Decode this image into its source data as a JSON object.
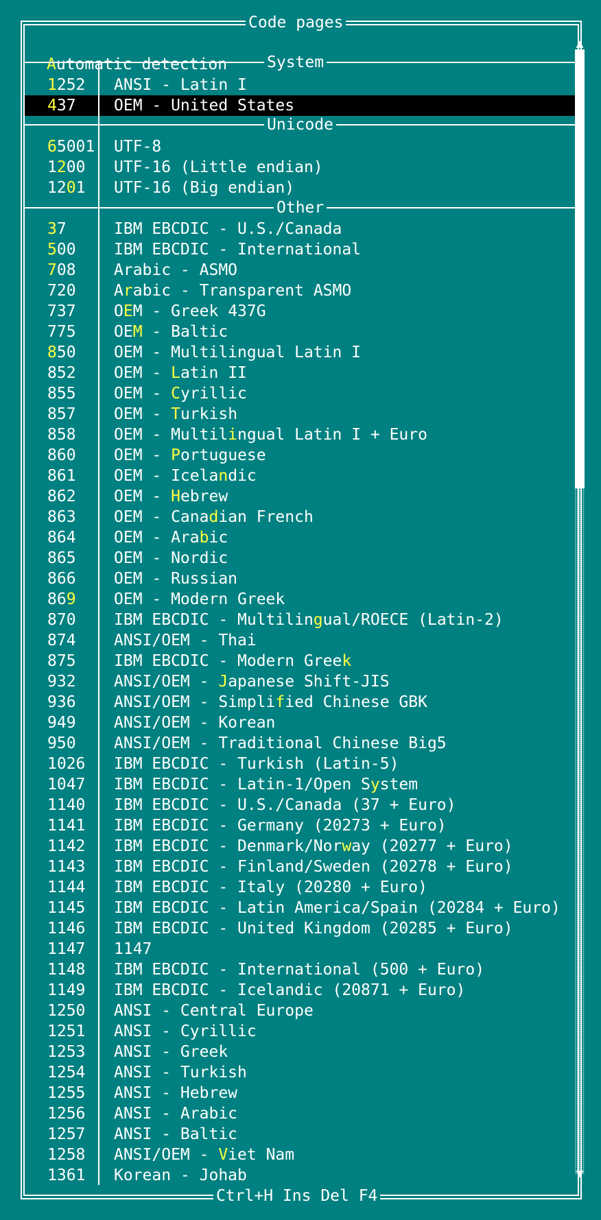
{
  "dialog": {
    "title": "Code pages",
    "footer": "Ctrl+H Ins Del F4",
    "auto_detect": {
      "hot": "A",
      "rest": "utomatic detection"
    },
    "scroll_up_icon": "▲",
    "scroll_down_icon": "▼"
  },
  "sections": {
    "system": "System",
    "unicode": "Unicode",
    "other": "Other"
  },
  "system_rows": [
    {
      "code": [
        [
          "1",
          "h"
        ],
        [
          "252",
          "n"
        ]
      ],
      "name": [
        [
          "ANSI - Latin I",
          "n"
        ]
      ]
    },
    {
      "code": [
        [
          "4",
          "h"
        ],
        [
          "37",
          "n"
        ]
      ],
      "name": [
        [
          "OEM - United States",
          "n"
        ]
      ],
      "selected": true
    }
  ],
  "unicode_rows": [
    {
      "code": [
        [
          "6",
          "h"
        ],
        [
          "5001",
          "n"
        ]
      ],
      "name": [
        [
          "UTF-8",
          "n"
        ]
      ]
    },
    {
      "code": [
        [
          "1",
          "n"
        ],
        [
          "2",
          "h"
        ],
        [
          "00",
          "n"
        ]
      ],
      "name": [
        [
          "UTF-16 (Little endian)",
          "n"
        ]
      ]
    },
    {
      "code": [
        [
          "12",
          "n"
        ],
        [
          "0",
          "h"
        ],
        [
          "1",
          "n"
        ]
      ],
      "name": [
        [
          "UTF-16 (Big endian)",
          "n"
        ]
      ]
    }
  ],
  "other_rows": [
    {
      "code": [
        [
          "3",
          "h"
        ],
        [
          "7",
          "n"
        ]
      ],
      "name": [
        [
          "IBM EBCDIC - U.S./Canada",
          "n"
        ]
      ]
    },
    {
      "code": [
        [
          "5",
          "h"
        ],
        [
          "00",
          "n"
        ]
      ],
      "name": [
        [
          "IBM EBCDIC - International",
          "n"
        ]
      ]
    },
    {
      "code": [
        [
          "7",
          "h"
        ],
        [
          "08",
          "n"
        ]
      ],
      "name": [
        [
          "Arabic - ASMO",
          "n"
        ]
      ]
    },
    {
      "code": [
        [
          "720",
          "n"
        ]
      ],
      "name": [
        [
          "A",
          "n"
        ],
        [
          "r",
          "h"
        ],
        [
          "abic - Transparent ASMO",
          "n"
        ]
      ]
    },
    {
      "code": [
        [
          "737",
          "n"
        ]
      ],
      "name": [
        [
          "O",
          "n"
        ],
        [
          "E",
          "h"
        ],
        [
          "M - Greek 437G",
          "n"
        ]
      ]
    },
    {
      "code": [
        [
          "775",
          "n"
        ]
      ],
      "name": [
        [
          "OE",
          "n"
        ],
        [
          "M",
          "h"
        ],
        [
          " - Baltic",
          "n"
        ]
      ]
    },
    {
      "code": [
        [
          "8",
          "h"
        ],
        [
          "50",
          "n"
        ]
      ],
      "name": [
        [
          "OEM - Multilingual Latin I",
          "n"
        ]
      ]
    },
    {
      "code": [
        [
          "852",
          "n"
        ]
      ],
      "name": [
        [
          "OEM - ",
          "n"
        ],
        [
          "L",
          "h"
        ],
        [
          "atin II",
          "n"
        ]
      ]
    },
    {
      "code": [
        [
          "855",
          "n"
        ]
      ],
      "name": [
        [
          "OEM - ",
          "n"
        ],
        [
          "C",
          "h"
        ],
        [
          "yrillic",
          "n"
        ]
      ]
    },
    {
      "code": [
        [
          "857",
          "n"
        ]
      ],
      "name": [
        [
          "OEM - ",
          "n"
        ],
        [
          "T",
          "h"
        ],
        [
          "urkish",
          "n"
        ]
      ]
    },
    {
      "code": [
        [
          "858",
          "n"
        ]
      ],
      "name": [
        [
          "OEM - Multil",
          "n"
        ],
        [
          "i",
          "h"
        ],
        [
          "ngual Latin I + Euro",
          "n"
        ]
      ]
    },
    {
      "code": [
        [
          "860",
          "n"
        ]
      ],
      "name": [
        [
          "OEM - ",
          "n"
        ],
        [
          "P",
          "h"
        ],
        [
          "ortuguese",
          "n"
        ]
      ]
    },
    {
      "code": [
        [
          "861",
          "n"
        ]
      ],
      "name": [
        [
          "OEM - Icela",
          "n"
        ],
        [
          "n",
          "h"
        ],
        [
          "dic",
          "n"
        ]
      ]
    },
    {
      "code": [
        [
          "862",
          "n"
        ]
      ],
      "name": [
        [
          "OEM - ",
          "n"
        ],
        [
          "H",
          "h"
        ],
        [
          "ebrew",
          "n"
        ]
      ]
    },
    {
      "code": [
        [
          "863",
          "n"
        ]
      ],
      "name": [
        [
          "OEM - Cana",
          "n"
        ],
        [
          "d",
          "h"
        ],
        [
          "ian French",
          "n"
        ]
      ]
    },
    {
      "code": [
        [
          "864",
          "n"
        ]
      ],
      "name": [
        [
          "OEM - Ara",
          "n"
        ],
        [
          "b",
          "h"
        ],
        [
          "ic",
          "n"
        ]
      ]
    },
    {
      "code": [
        [
          "865",
          "n"
        ]
      ],
      "name": [
        [
          "OEM - Nordic",
          "n"
        ]
      ]
    },
    {
      "code": [
        [
          "866",
          "n"
        ]
      ],
      "name": [
        [
          "OEM - Russian",
          "n"
        ]
      ]
    },
    {
      "code": [
        [
          "86",
          "n"
        ],
        [
          "9",
          "h"
        ]
      ],
      "name": [
        [
          "OEM - Modern Greek",
          "n"
        ]
      ]
    },
    {
      "code": [
        [
          "870",
          "n"
        ]
      ],
      "name": [
        [
          "IBM EBCDIC - Multilin",
          "n"
        ],
        [
          "g",
          "h"
        ],
        [
          "ual/ROECE (Latin-2)",
          "n"
        ]
      ]
    },
    {
      "code": [
        [
          "874",
          "n"
        ]
      ],
      "name": [
        [
          "ANSI/OEM - Thai",
          "n"
        ]
      ]
    },
    {
      "code": [
        [
          "875",
          "n"
        ]
      ],
      "name": [
        [
          "IBM EBCDIC - Modern Gree",
          "n"
        ],
        [
          "k",
          "h"
        ]
      ]
    },
    {
      "code": [
        [
          "932",
          "n"
        ]
      ],
      "name": [
        [
          "ANSI/OEM - ",
          "n"
        ],
        [
          "J",
          "h"
        ],
        [
          "apanese Shift-JIS",
          "n"
        ]
      ]
    },
    {
      "code": [
        [
          "936",
          "n"
        ]
      ],
      "name": [
        [
          "ANSI/OEM - Simpli",
          "n"
        ],
        [
          "f",
          "h"
        ],
        [
          "ied Chinese GBK",
          "n"
        ]
      ]
    },
    {
      "code": [
        [
          "949",
          "n"
        ]
      ],
      "name": [
        [
          "ANSI/OEM - Korean",
          "n"
        ]
      ]
    },
    {
      "code": [
        [
          "950",
          "n"
        ]
      ],
      "name": [
        [
          "ANSI/OEM - Traditional Chinese Big5",
          "n"
        ]
      ]
    },
    {
      "code": [
        [
          "1026",
          "n"
        ]
      ],
      "name": [
        [
          "IBM EBCDIC - Turkish (Latin-5)",
          "n"
        ]
      ]
    },
    {
      "code": [
        [
          "1047",
          "n"
        ]
      ],
      "name": [
        [
          "IBM EBCDIC - Latin-1/Open S",
          "n"
        ],
        [
          "y",
          "h"
        ],
        [
          "stem",
          "n"
        ]
      ]
    },
    {
      "code": [
        [
          "1140",
          "n"
        ]
      ],
      "name": [
        [
          "IBM EBCDIC - U.S./Canada (37 + Euro)",
          "n"
        ]
      ]
    },
    {
      "code": [
        [
          "1141",
          "n"
        ]
      ],
      "name": [
        [
          "IBM EBCDIC - Germany (20273 + Euro)",
          "n"
        ]
      ]
    },
    {
      "code": [
        [
          "1142",
          "n"
        ]
      ],
      "name": [
        [
          "IBM EBCDIC - Denmark/Nor",
          "n"
        ],
        [
          "w",
          "h"
        ],
        [
          "ay (20277 + Euro)",
          "n"
        ]
      ]
    },
    {
      "code": [
        [
          "1143",
          "n"
        ]
      ],
      "name": [
        [
          "IBM EBCDIC - Finland/Sweden (20278 + Euro)",
          "n"
        ]
      ]
    },
    {
      "code": [
        [
          "1144",
          "n"
        ]
      ],
      "name": [
        [
          "IBM EBCDIC - Italy (20280 + Euro)",
          "n"
        ]
      ]
    },
    {
      "code": [
        [
          "1145",
          "n"
        ]
      ],
      "name": [
        [
          "IBM EBCDIC - Latin America/Spain (20284 + Euro)",
          "n"
        ]
      ]
    },
    {
      "code": [
        [
          "1146",
          "n"
        ]
      ],
      "name": [
        [
          "IBM EBCDIC - United Kingdom (20285 + Euro)",
          "n"
        ]
      ]
    },
    {
      "code": [
        [
          "1147",
          "n"
        ]
      ],
      "name": [
        [
          "1147",
          "n"
        ]
      ]
    },
    {
      "code": [
        [
          "1148",
          "n"
        ]
      ],
      "name": [
        [
          "IBM EBCDIC - International (500 + Euro)",
          "n"
        ]
      ]
    },
    {
      "code": [
        [
          "1149",
          "n"
        ]
      ],
      "name": [
        [
          "IBM EBCDIC - Icelandic (20871 + Euro)",
          "n"
        ]
      ]
    },
    {
      "code": [
        [
          "1250",
          "n"
        ]
      ],
      "name": [
        [
          "ANSI - Central Europe",
          "n"
        ]
      ]
    },
    {
      "code": [
        [
          "1251",
          "n"
        ]
      ],
      "name": [
        [
          "ANSI - Cyrillic",
          "n"
        ]
      ]
    },
    {
      "code": [
        [
          "1253",
          "n"
        ]
      ],
      "name": [
        [
          "ANSI - Greek",
          "n"
        ]
      ]
    },
    {
      "code": [
        [
          "1254",
          "n"
        ]
      ],
      "name": [
        [
          "ANSI - Turkish",
          "n"
        ]
      ]
    },
    {
      "code": [
        [
          "1255",
          "n"
        ]
      ],
      "name": [
        [
          "ANSI - Hebrew",
          "n"
        ]
      ]
    },
    {
      "code": [
        [
          "1256",
          "n"
        ]
      ],
      "name": [
        [
          "ANSI - Arabic",
          "n"
        ]
      ]
    },
    {
      "code": [
        [
          "1257",
          "n"
        ]
      ],
      "name": [
        [
          "ANSI - Baltic",
          "n"
        ]
      ]
    },
    {
      "code": [
        [
          "1258",
          "n"
        ]
      ],
      "name": [
        [
          "ANSI/OEM - ",
          "n"
        ],
        [
          "V",
          "h"
        ],
        [
          "iet Nam",
          "n"
        ]
      ]
    },
    {
      "code": [
        [
          "1361",
          "n"
        ]
      ],
      "name": [
        [
          "Korean - Johab",
          "n"
        ]
      ]
    }
  ],
  "scrollbar": {
    "thumb_fraction": 0.39
  },
  "colors": {
    "background": "#008080",
    "text": "#ffffff",
    "hotkey": "#ffff40",
    "selection": "#000000"
  }
}
